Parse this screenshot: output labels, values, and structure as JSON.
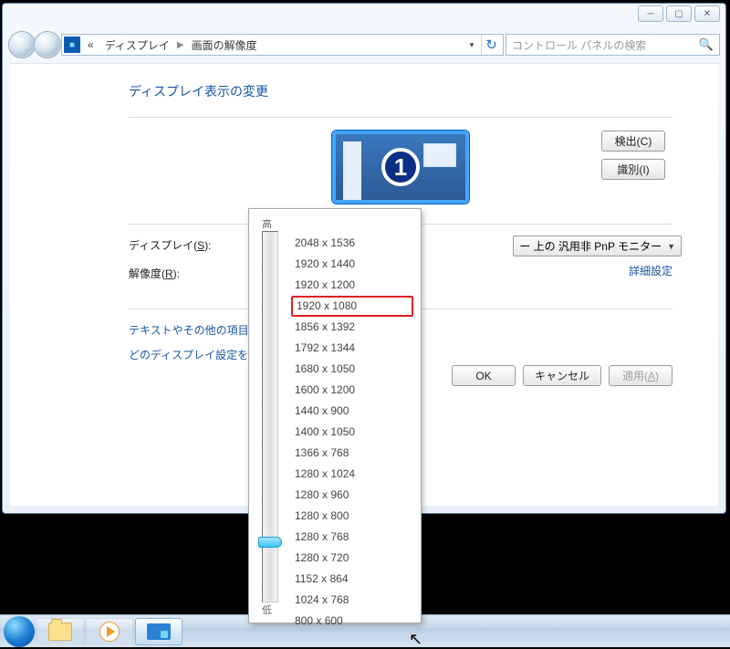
{
  "breadcrumb": {
    "back": "«",
    "item1": "ディスプレイ",
    "item2": "画面の解像度"
  },
  "search_placeholder": "コントロール パネルの検索",
  "page_title": "ディスプレイ表示の変更",
  "monitor_number": "1",
  "buttons": {
    "detect": "検出(C)",
    "identify": "識別(I)",
    "ok": "OK",
    "cancel": "キャンセル",
    "apply": "適用(A)"
  },
  "labels": {
    "display": "ディスプレイ(S):",
    "resolution": "解像度(R):",
    "slider_high": "高",
    "slider_low": "低"
  },
  "display_dropdown_tail": "ー 上の 汎用非 PnP モニター",
  "links": {
    "advanced": "詳細設定",
    "textsize": "テキストやその他の項目の",
    "whichdisplay": "どのディスプレイ設定を選"
  },
  "resolutions": [
    "2048 x 1536",
    "1920 x 1440",
    "1920 x 1200",
    "1920 x 1080",
    "1856 x 1392",
    "1792 x 1344",
    "1680 x 1050",
    "1600 x 1200",
    "1440 x 900",
    "1400 x 1050",
    "1366 x 768",
    "1280 x 1024",
    "1280 x 960",
    "1280 x 800",
    "1280 x 768",
    "1280 x 720",
    "1152 x 864",
    "1024 x 768",
    "800 x 600"
  ],
  "highlight_index": 3
}
